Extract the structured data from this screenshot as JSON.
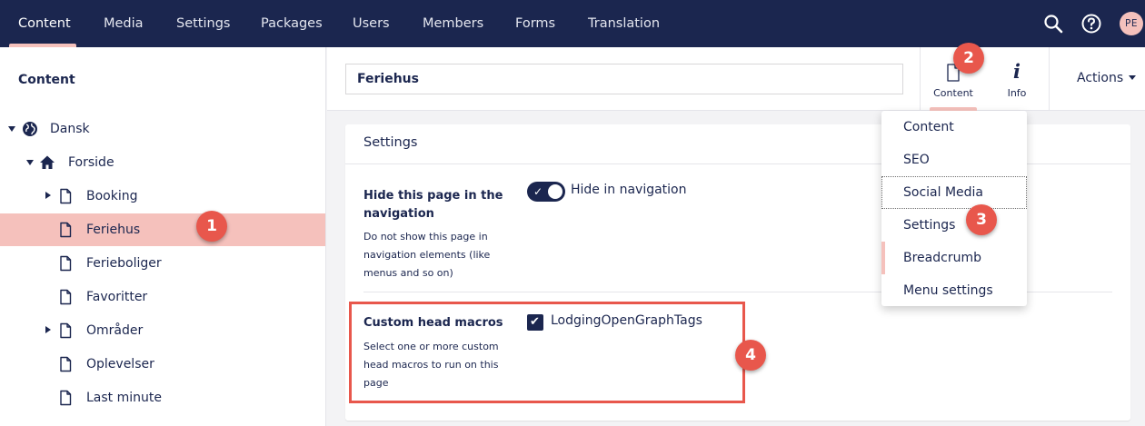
{
  "topnav": {
    "sections": [
      "Content",
      "Media",
      "Settings",
      "Packages",
      "Users",
      "Members",
      "Forms",
      "Translation"
    ],
    "active": "Content",
    "search_icon": "search-icon",
    "help_icon": "help-icon",
    "avatar_initials": "PE"
  },
  "sidebar": {
    "title": "Content",
    "tree": [
      {
        "label": "Dansk",
        "icon": "globe-icon",
        "expander": "expanded"
      },
      {
        "label": "Forside",
        "icon": "home-icon",
        "expander": "expanded"
      },
      {
        "label": "Booking",
        "icon": "document-icon",
        "expander": "collapsed"
      },
      {
        "label": "Feriehus",
        "icon": "document-icon",
        "expander": "none",
        "selected": true
      },
      {
        "label": "Ferieboliger",
        "icon": "document-icon",
        "expander": "none"
      },
      {
        "label": "Favoritter",
        "icon": "document-icon",
        "expander": "none"
      },
      {
        "label": "Områder",
        "icon": "document-icon",
        "expander": "collapsed"
      },
      {
        "label": "Oplevelser",
        "icon": "document-icon",
        "expander": "none"
      },
      {
        "label": "Last minute",
        "icon": "document-icon",
        "expander": "none"
      }
    ]
  },
  "header": {
    "node_name": "Feriehus",
    "apps": [
      {
        "label": "Content",
        "icon": "document-icon"
      },
      {
        "label": "Info",
        "icon": "info-icon"
      }
    ],
    "actions_label": "Actions"
  },
  "panel": {
    "title": "Settings",
    "properties": [
      {
        "label": "Hide this page in the navigation",
        "description": "Do not show this page in navigation elements (like menus and so on)",
        "control": "toggle",
        "value": true,
        "value_label": "Hide in navigation"
      },
      {
        "label": "Custom head macros",
        "description": "Select one or more custom head macros to run on this page",
        "control": "checkbox",
        "value": true,
        "value_label": "LodgingOpenGraphTags"
      }
    ]
  },
  "dropdown": {
    "items": [
      "Content",
      "SEO",
      "Social Media",
      "Settings",
      "Breadcrumb",
      "Menu settings"
    ],
    "focused": "Social Media",
    "active": "Breadcrumb"
  },
  "annotations": [
    "1",
    "2",
    "3",
    "4"
  ],
  "colors": {
    "nav_bg": "#1b264f",
    "accent_pink": "#f5c1bc",
    "annotation_red": "#e8574c"
  }
}
